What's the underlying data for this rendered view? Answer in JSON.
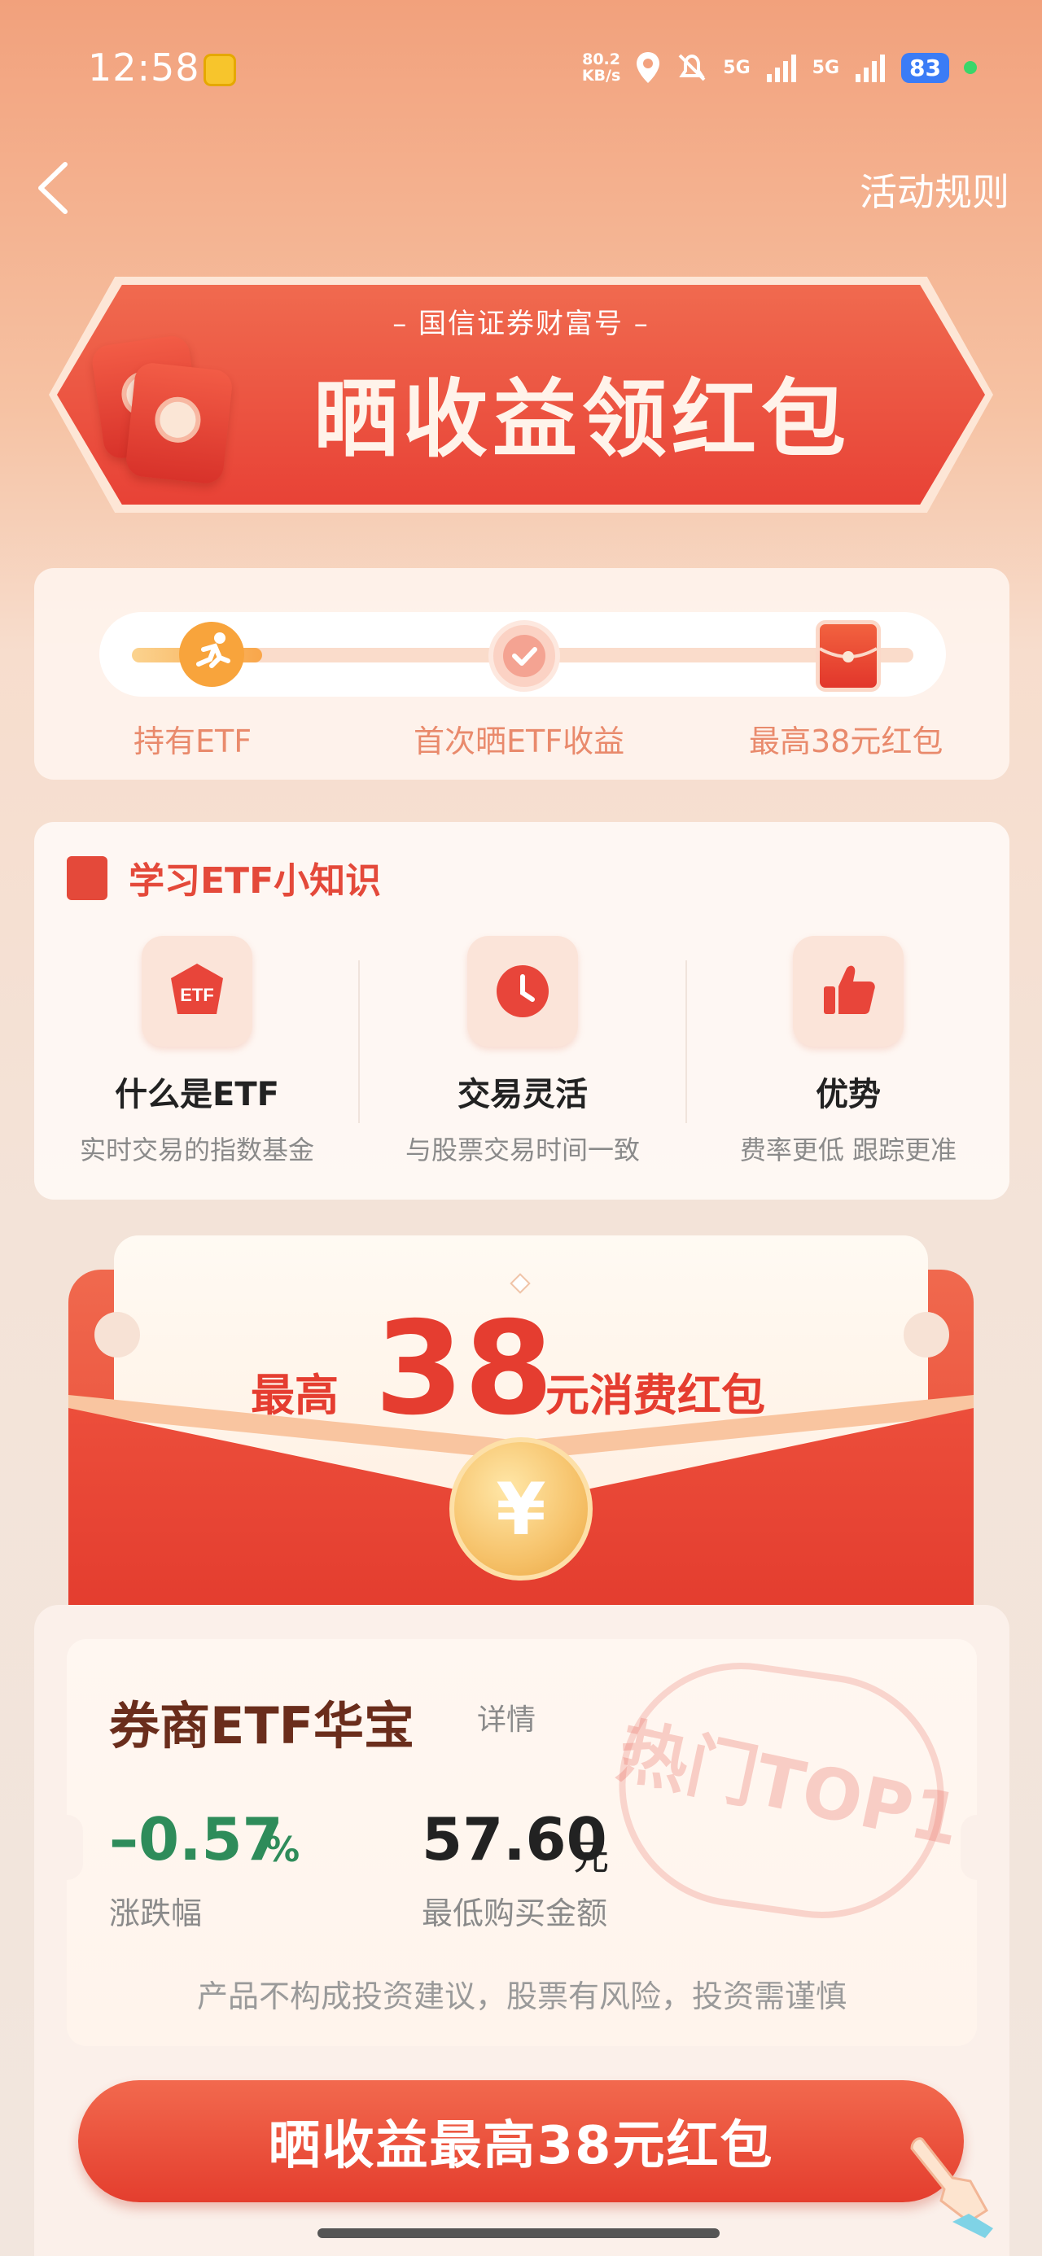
{
  "status_bar": {
    "time": "12:58",
    "net_speed_value": "80.2",
    "net_speed_unit": "KB/s",
    "signal1": "5G",
    "signal2": "5G",
    "battery": "83"
  },
  "nav": {
    "back_icon": "chevron-left-icon",
    "rules_label": "活动规则"
  },
  "banner": {
    "subtitle": "– 国信证券财富号 –",
    "title": "晒收益领红包"
  },
  "progress": {
    "steps": [
      {
        "label": "持有ETF",
        "icon": "runner-icon"
      },
      {
        "label": "首次晒ETF收益",
        "icon": "check-icon"
      },
      {
        "label": "最高38元红包",
        "icon": "red-envelope-icon"
      }
    ]
  },
  "knowledge": {
    "title": "学习ETF小知识",
    "items": [
      {
        "name": "什么是ETF",
        "desc": "实时交易的指数基金",
        "icon_text": "ETF"
      },
      {
        "name": "交易灵活",
        "desc": "与股票交易时间一致"
      },
      {
        "name": "优势",
        "desc": "费率更低 跟踪更准"
      }
    ]
  },
  "envelope": {
    "prefix": "最高",
    "amount": "38",
    "suffix": "元消费红包",
    "coin_symbol": "¥"
  },
  "product": {
    "name": "券商ETF华宝",
    "detail_label": "详情",
    "stamp_text": "热门TOP1",
    "change_value": "–0.57",
    "change_unit": "%",
    "change_label": "涨跌幅",
    "min_amount": "57.60",
    "min_unit": "元",
    "min_label": "最低购买金额",
    "disclaimer": "产品不构成投资建议，股票有风险，投资需谨慎"
  },
  "cta": {
    "label": "晒收益最高38元红包"
  },
  "colors": {
    "accent_red": "#e53d30",
    "positive_green": "#2e8c5a",
    "brand_orange": "#f8a43c"
  }
}
